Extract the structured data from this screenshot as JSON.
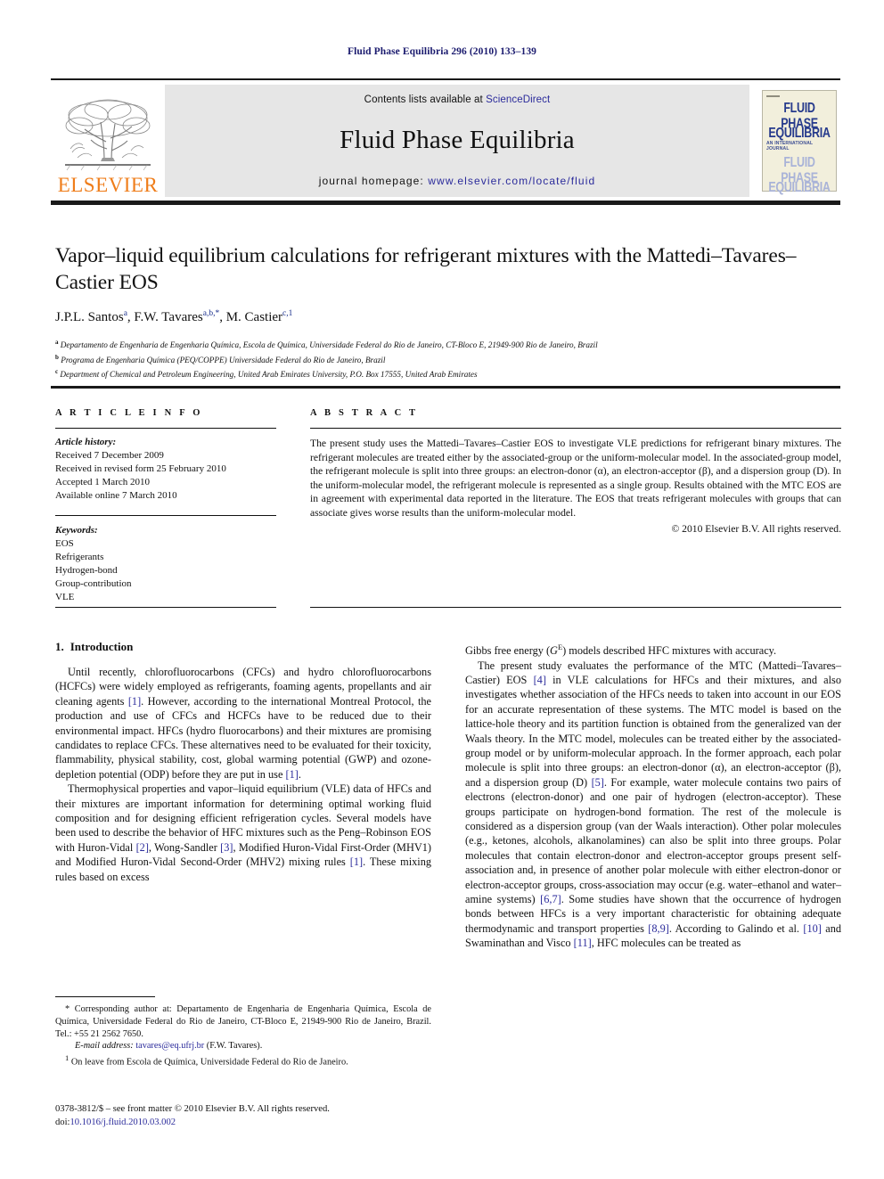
{
  "running_head": "Fluid Phase Equilibria 296 (2010) 133–139",
  "masthead": {
    "publisher_logo_text": "ELSEVIER",
    "contents_prefix": "Contents lists available at ",
    "contents_link": "ScienceDirect",
    "journal_title": "Fluid Phase Equilibria",
    "homepage_prefix": "journal homepage: ",
    "homepage_url": "www.elsevier.com/locate/fluid",
    "cover": {
      "line1": "FLUID PHASE",
      "line2": "EQUILIBRIA",
      "subtitle": "AN INTERNATIONAL JOURNAL",
      "line3": "FLUID PHASE",
      "line4": "EQUILIBRIA"
    },
    "accent_orange": "#ef7d1a",
    "link_blue": "#2b2b9b",
    "band_gray": "#e6e6e6"
  },
  "article": {
    "title": "Vapor–liquid equilibrium calculations for refrigerant mixtures with the Mattedi–Tavares–Castier EOS",
    "authors_html": "J.P.L. Santos<sup>a</sup>, F.W. Tavares<sup>a,b,*</sup>, M. Castier<sup>c,1</sup>",
    "affiliations": [
      {
        "mark": "a",
        "text": "Departamento de Engenharia de Engenharia Química, Escola de Química, Universidade Federal do Rio de Janeiro, CT-Bloco E, 21949-900 Rio de Janeiro, Brazil"
      },
      {
        "mark": "b",
        "text": "Programa de Engenharia Química (PEQ/COPPE) Universidade Federal do Rio de Janeiro, Brazil"
      },
      {
        "mark": "c",
        "text": "Department of Chemical and Petroleum Engineering, United Arab Emirates University, P.O. Box 17555, United Arab Emirates"
      }
    ]
  },
  "article_info": {
    "heading": "A R T I C L E   I N F O",
    "history_label": "Article history:",
    "history": [
      "Received 7 December 2009",
      "Received in revised form 25 February 2010",
      "Accepted 1 March 2010",
      "Available online 7 March 2010"
    ],
    "keywords_label": "Keywords:",
    "keywords": [
      "EOS",
      "Refrigerants",
      "Hydrogen-bond",
      "Group-contribution",
      "VLE"
    ]
  },
  "abstract": {
    "heading": "A B S T R A C T",
    "text": "The present study uses the Mattedi–Tavares–Castier EOS to investigate VLE predictions for refrigerant binary mixtures. The refrigerant molecules are treated either by the associated-group or the uniform-molecular model. In the associated-group model, the refrigerant molecule is split into three groups: an electron-donor (α), an electron-acceptor (β), and a dispersion group (D). In the uniform-molecular model, the refrigerant molecule is represented as a single group. Results obtained with the MTC EOS are in agreement with experimental data reported in the literature. The EOS that treats refrigerant molecules with groups that can associate gives worse results than the uniform-molecular model.",
    "copyright": "© 2010 Elsevier B.V. All rights reserved."
  },
  "sections": {
    "intro_number": "1.",
    "intro_title": "Introduction"
  },
  "body": {
    "left_p1": "Until recently, chlorofluorocarbons (CFCs) and hydro chlorofluorocarbons (HCFCs) were widely employed as refrigerants, foaming agents, propellants and air cleaning agents [1]. However, according to the international Montreal Protocol, the production and use of CFCs and HCFCs have to be reduced due to their environmental impact. HFCs (hydro fluorocarbons) and their mixtures are promising candidates to replace CFCs. These alternatives need to be evaluated for their toxicity, flammability, physical stability, cost, global warming potential (GWP) and ozone-depletion potential (ODP) before they are put in use [1].",
    "left_p2": "Thermophysical properties and vapor–liquid equilibrium (VLE) data of HFCs and their mixtures are important information for determining optimal working fluid composition and for designing efficient refrigeration cycles. Several models have been used to describe the behavior of HFC mixtures such as the Peng–Robinson EOS with Huron-Vidal [2], Wong-Sandler [3], Modified Huron-Vidal First-Order (MHV1) and Modified Huron-Vidal Second-Order (MHV2) mixing rules [1]. These mixing rules based on excess",
    "right_p1_tail": "Gibbs free energy (GE) models described HFC mixtures with accuracy.",
    "right_p2": "The present study evaluates the performance of the MTC (Mattedi–Tavares–Castier) EOS [4] in VLE calculations for HFCs and their mixtures, and also investigates whether association of the HFCs needs to taken into account in our EOS for an accurate representation of these systems. The MTC model is based on the lattice-hole theory and its partition function is obtained from the generalized van der Waals theory. In the MTC model, molecules can be treated either by the associated-group model or by uniform-molecular approach. In the former approach, each polar molecule is split into three groups: an electron-donor (α), an electron-acceptor (β), and a dispersion group (D) [5]. For example, water molecule contains two pairs of electrons (electron-donor) and one pair of hydrogen (electron-acceptor). These groups participate on hydrogen-bond formation. The rest of the molecule is considered as a dispersion group (van der Waals interaction). Other polar molecules (e.g., ketones, alcohols, alkanolamines) can also be split into three groups. Polar molecules that contain electron-donor and electron-acceptor groups present self-association and, in presence of another polar molecule with either electron-donor or electron-acceptor groups, cross-association may occur (e.g. water–ethanol and water–amine systems) [6,7]. Some studies have shown that the occurrence of hydrogen bonds between HFCs is a very important characteristic for obtaining adequate thermodynamic and transport properties [8,9]. According to Galindo et al. [10] and Swaminathan and Visco [11], HFC molecules can be treated as"
  },
  "footnotes": {
    "corresponding": "* Corresponding author at: Departamento de Engenharia de Engenharia Química, Escola de Química, Universidade Federal do Rio de Janeiro, CT-Bloco E, 21949-900 Rio de Janeiro, Brazil. Tel.: +55 21 2562 7650.",
    "email_label": "E-mail address:",
    "email": "tavares@eq.ufrj.br",
    "email_suffix": "(F.W. Tavares).",
    "note1_mark": "1",
    "note1": "On leave from Escola de Química, Universidade Federal do Rio de Janeiro."
  },
  "imprint": {
    "line1": "0378-3812/$ – see front matter © 2010 Elsevier B.V. All rights reserved.",
    "doi_label": "doi:",
    "doi": "10.1016/j.fluid.2010.03.002"
  }
}
